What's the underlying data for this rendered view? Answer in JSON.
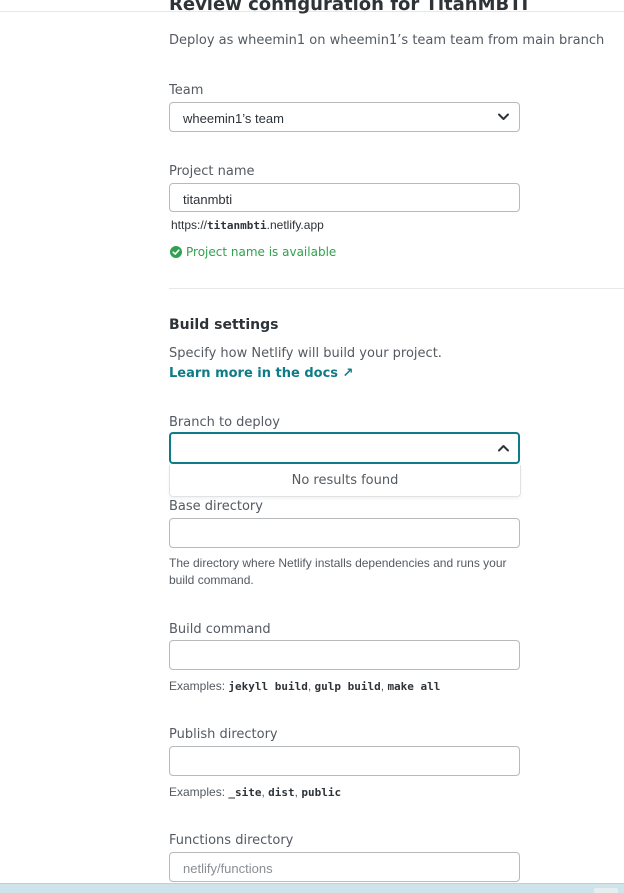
{
  "header": {
    "title": "Review configuration for TitanMBTI",
    "subtitle": "Deploy as wheemin1 on wheemin1’s team team from main branch"
  },
  "team": {
    "label": "Team",
    "selected": "wheemin1’s team"
  },
  "project": {
    "label": "Project name",
    "value": "titanmbti",
    "url_prefix": "https://",
    "url_name": "titanmbti",
    "url_suffix": ".netlify.app",
    "status": "Project name is available"
  },
  "build": {
    "title": "Build settings",
    "description": "Specify how Netlify will build your project.",
    "docs_link": "Learn more in the docs ↗",
    "branch": {
      "label": "Branch to deploy",
      "value": "",
      "empty_message": "No results found"
    },
    "base_dir": {
      "label": "Base directory",
      "value": "",
      "help": "The directory where Netlify installs dependencies and runs your build command."
    },
    "command": {
      "label": "Build command",
      "value": "",
      "help_prefix": "Examples:",
      "examples": [
        "jekyll build",
        "gulp build",
        "make all"
      ]
    },
    "publish": {
      "label": "Publish directory",
      "value": "",
      "help_prefix": "Examples:",
      "examples": [
        "_site",
        "dist",
        "public"
      ]
    },
    "functions": {
      "label": "Functions directory",
      "placeholder": "netlify/functions"
    }
  },
  "colors": {
    "accent": "#0e7c86",
    "success": "#30a14e",
    "border": "#b6babd"
  },
  "icons": {
    "select_chevron": "chevron-down-icon",
    "open_chevron": "chevron-up-icon",
    "status": "check-circle-icon"
  }
}
